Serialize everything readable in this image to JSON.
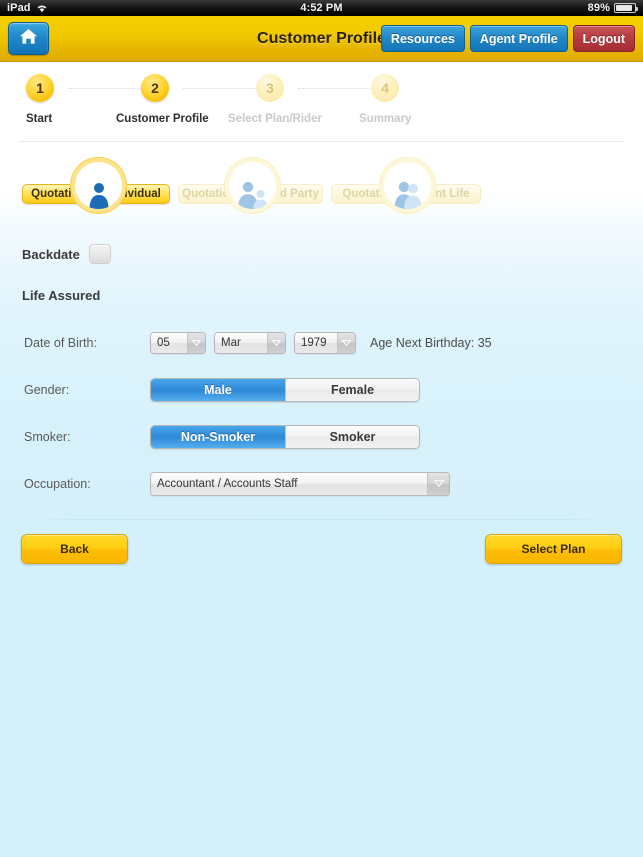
{
  "statusbar": {
    "device": "iPad",
    "wifi_icon": "wifi-icon",
    "time": "4:52 PM",
    "battery_percent": "89%",
    "battery_icon": "battery-icon"
  },
  "header": {
    "home_icon": "home-icon",
    "title": "Customer Profile",
    "buttons": [
      {
        "label": "Resources",
        "style": "blue"
      },
      {
        "label": "Agent Profile",
        "style": "blue"
      },
      {
        "label": "Logout",
        "style": "red"
      }
    ]
  },
  "steps": [
    {
      "number": "1",
      "label": "Start",
      "state": "active"
    },
    {
      "number": "2",
      "label": "Customer Profile",
      "state": "active"
    },
    {
      "number": "3",
      "label": "Select Plan/Rider",
      "state": "inactive"
    },
    {
      "number": "4",
      "label": "Summary",
      "state": "inactive"
    }
  ],
  "quotation_tabs": [
    {
      "label": "Quotation for Individual",
      "icon": "single-person-icon",
      "selected": true
    },
    {
      "label": "Quotation for Third Party",
      "icon": "two-persons-icon",
      "selected": false
    },
    {
      "label": "Quotation for Joint Life",
      "icon": "couple-icon",
      "selected": false
    }
  ],
  "backdate": {
    "label": "Backdate",
    "checked": false
  },
  "form": {
    "section_title": "Life Assured",
    "date_of_birth": {
      "label": "Date of Birth:",
      "day": "05",
      "month": "Mar",
      "year": "1979",
      "age_text": "Age Next Birthday: 35"
    },
    "gender": {
      "label": "Gender:",
      "options": [
        "Male",
        "Female"
      ],
      "selected": "Male"
    },
    "smoker": {
      "label": "Smoker:",
      "options": [
        "Non-Smoker",
        "Smoker"
      ],
      "selected": "Non-Smoker"
    },
    "occupation": {
      "label": "Occupation:",
      "value": "Accountant / Accounts Staff"
    }
  },
  "footer": {
    "back_label": "Back",
    "select_plan_label": "Select Plan"
  },
  "colors": {
    "header_yellow": "#f1c900",
    "accent_blue": "#2287c8",
    "logout_red": "#b63b40",
    "page_blue": "#d4f0fb",
    "button_yellow": "#ffce12"
  }
}
